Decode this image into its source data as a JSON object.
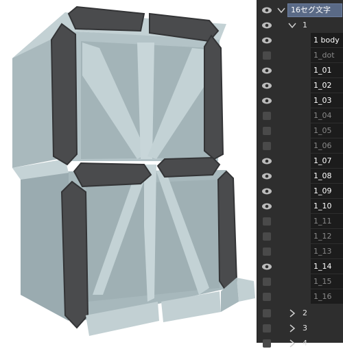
{
  "colors": {
    "segment_dark": "#4a4b4d",
    "segment_dark_edge": "#333436",
    "body_face": "#b9c8cc",
    "body_shadow": "#9fb0b4",
    "body_light": "#c8d6d9",
    "panel_bg": "#2e2e2e",
    "selected_row": "#5a6a86"
  },
  "layers": {
    "root": {
      "label": "16セグ文字",
      "icon": "eye-icon",
      "expanded": true
    },
    "group1": {
      "label": "1",
      "icon": "eye-icon",
      "expanded": true
    },
    "items": [
      {
        "label": "1 body",
        "visible": true
      },
      {
        "label": "1_dot",
        "visible": false
      },
      {
        "label": "1_01",
        "visible": true
      },
      {
        "label": "1_02",
        "visible": true
      },
      {
        "label": "1_03",
        "visible": true
      },
      {
        "label": "1_04",
        "visible": false
      },
      {
        "label": "1_05",
        "visible": false
      },
      {
        "label": "1_06",
        "visible": false
      },
      {
        "label": "1_07",
        "visible": true
      },
      {
        "label": "1_08",
        "visible": true
      },
      {
        "label": "1_09",
        "visible": true
      },
      {
        "label": "1_10",
        "visible": true
      },
      {
        "label": "1_11",
        "visible": false
      },
      {
        "label": "1_12",
        "visible": false
      },
      {
        "label": "1_13",
        "visible": false
      },
      {
        "label": "1_14",
        "visible": true
      },
      {
        "label": "1_15",
        "visible": false
      },
      {
        "label": "1_16",
        "visible": false
      }
    ],
    "collapsed_groups": [
      {
        "label": "2"
      },
      {
        "label": "3"
      },
      {
        "label": "4"
      }
    ]
  }
}
